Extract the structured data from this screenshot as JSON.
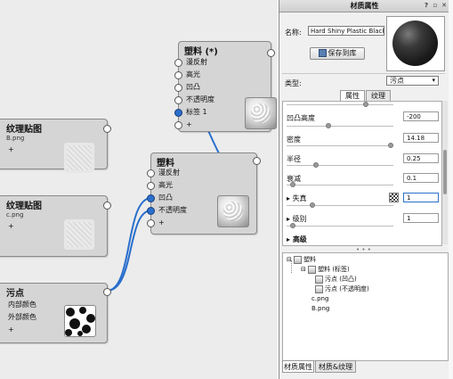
{
  "canvas": {
    "nodes": {
      "plastic_top": {
        "title": "塑料 (*)",
        "ports": [
          "漫反射",
          "高光",
          "凹凸",
          "不透明度",
          "标签 1",
          "+"
        ]
      },
      "plastic_mid": {
        "title": "塑料",
        "ports": [
          "漫反射",
          "高光",
          "凹凸",
          "不透明度",
          "+"
        ]
      },
      "texture_b": {
        "title": "纹理贴图",
        "file": "B.png",
        "ports": [
          "+"
        ]
      },
      "texture_c": {
        "title": "纹理贴图",
        "file": "c.png",
        "ports": [
          "+"
        ]
      },
      "spots": {
        "title": "污点",
        "ports": [
          "内部颜色",
          "外部颜色",
          "+"
        ]
      }
    },
    "link_color": "#2a6fcc"
  },
  "panel": {
    "title": "材质属性",
    "name_label": "名称:",
    "name_value": "Hard Shiny Plastic Black #31",
    "save_button": "保存到库",
    "type_label": "类型:",
    "type_value": "污点",
    "tabs": [
      "属性",
      "纹理"
    ],
    "active_tab": "属性",
    "properties": [
      {
        "label": "凹凸高度",
        "value": "-200",
        "slider": 0.1
      },
      {
        "label": "密度",
        "value": "14.18",
        "slider": 0.7
      },
      {
        "label": "半径",
        "value": "0.25",
        "slider": 0.12
      },
      {
        "label": "衰减",
        "value": "0.1",
        "slider": 0.03
      },
      {
        "label": "失真",
        "value": "1",
        "slider": 0.04,
        "expandable": true
      },
      {
        "label": "级别",
        "value": "1",
        "slider": 0.03,
        "expandable": true
      },
      {
        "label": "高级",
        "expandable": true
      }
    ],
    "tree": {
      "root": "塑料",
      "child": "塑料 (标签)",
      "leaves": [
        "污点 (凹凸)",
        "污点 (不透明度)"
      ],
      "files": [
        "c.png",
        "B.png"
      ]
    },
    "bottom_tabs": [
      "材质属性",
      "材质&纹理"
    ],
    "active_bottom_tab": "材质属性",
    "title_buttons": [
      "?",
      "▫",
      "✕"
    ]
  }
}
